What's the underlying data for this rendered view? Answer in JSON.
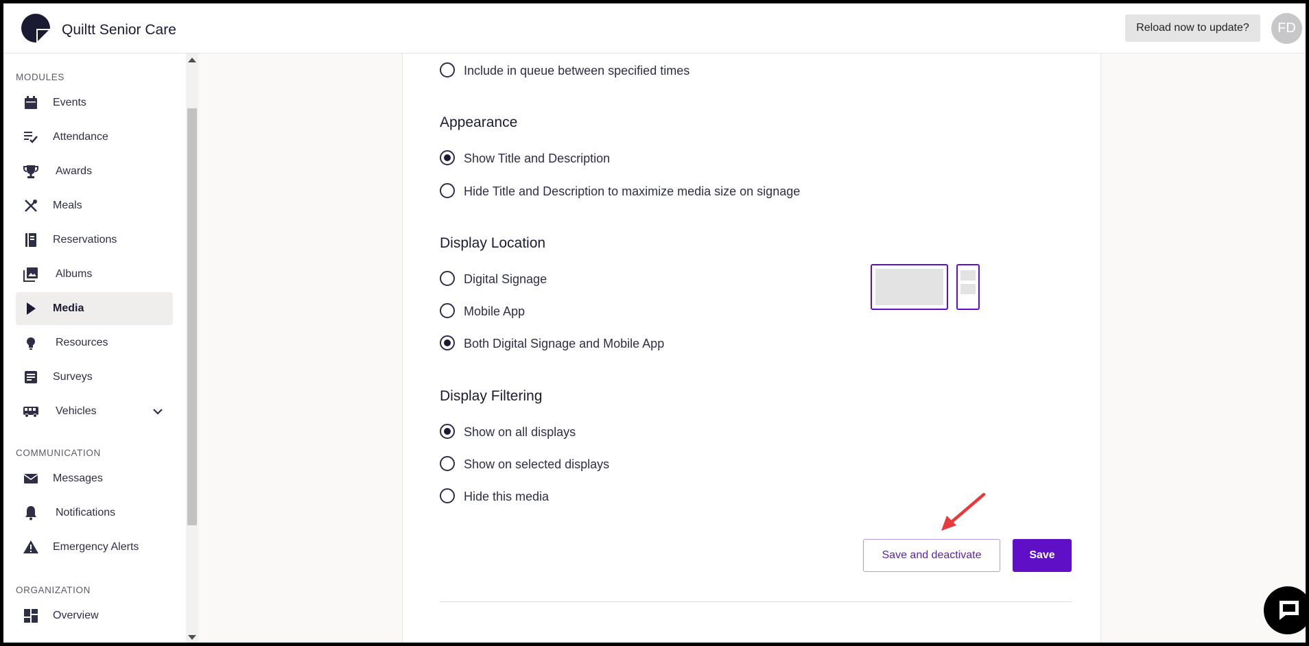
{
  "app": {
    "title": "Quiltt Senior Care",
    "reload_label": "Reload now to update?",
    "avatar_initials": "FD"
  },
  "sidebar": {
    "sections": {
      "modules": "MODULES",
      "communication": "COMMUNICATION",
      "organization": "ORGANIZATION"
    },
    "items": [
      {
        "label": "Events",
        "icon": "calendar-icon"
      },
      {
        "label": "Attendance",
        "icon": "checklist-icon"
      },
      {
        "label": "Awards",
        "icon": "trophy-icon"
      },
      {
        "label": "Meals",
        "icon": "utensils-icon"
      },
      {
        "label": "Reservations",
        "icon": "book-icon"
      },
      {
        "label": "Albums",
        "icon": "photos-icon"
      },
      {
        "label": "Media",
        "icon": "play-icon",
        "active": true
      },
      {
        "label": "Resources",
        "icon": "lightbulb-icon"
      },
      {
        "label": "Surveys",
        "icon": "survey-icon"
      },
      {
        "label": "Vehicles",
        "icon": "bus-icon"
      },
      {
        "label": "Messages",
        "icon": "mail-icon"
      },
      {
        "label": "Notifications",
        "icon": "bell-icon"
      },
      {
        "label": "Emergency Alerts",
        "icon": "warning-icon"
      },
      {
        "label": "Overview",
        "icon": "dashboard-icon"
      }
    ]
  },
  "form": {
    "queue_option": "Include in queue between specified times",
    "appearance": {
      "title": "Appearance",
      "options": [
        "Show Title and Description",
        "Hide Title and Description to maximize media size on signage"
      ],
      "selected": "Show Title and Description"
    },
    "location": {
      "title": "Display Location",
      "options": [
        "Digital Signage",
        "Mobile App",
        "Both Digital Signage and Mobile App"
      ],
      "selected": "Both Digital Signage and Mobile App"
    },
    "filtering": {
      "title": "Display Filtering",
      "options": [
        "Show on all displays",
        "Show on selected displays",
        "Hide this media"
      ],
      "selected": "Show on all displays"
    },
    "buttons": {
      "deactivate": "Save and deactivate",
      "save": "Save"
    }
  },
  "colors": {
    "primary": "#5f10c6",
    "navy": "#1b1a33",
    "annotation_arrow": "#e8393c"
  }
}
